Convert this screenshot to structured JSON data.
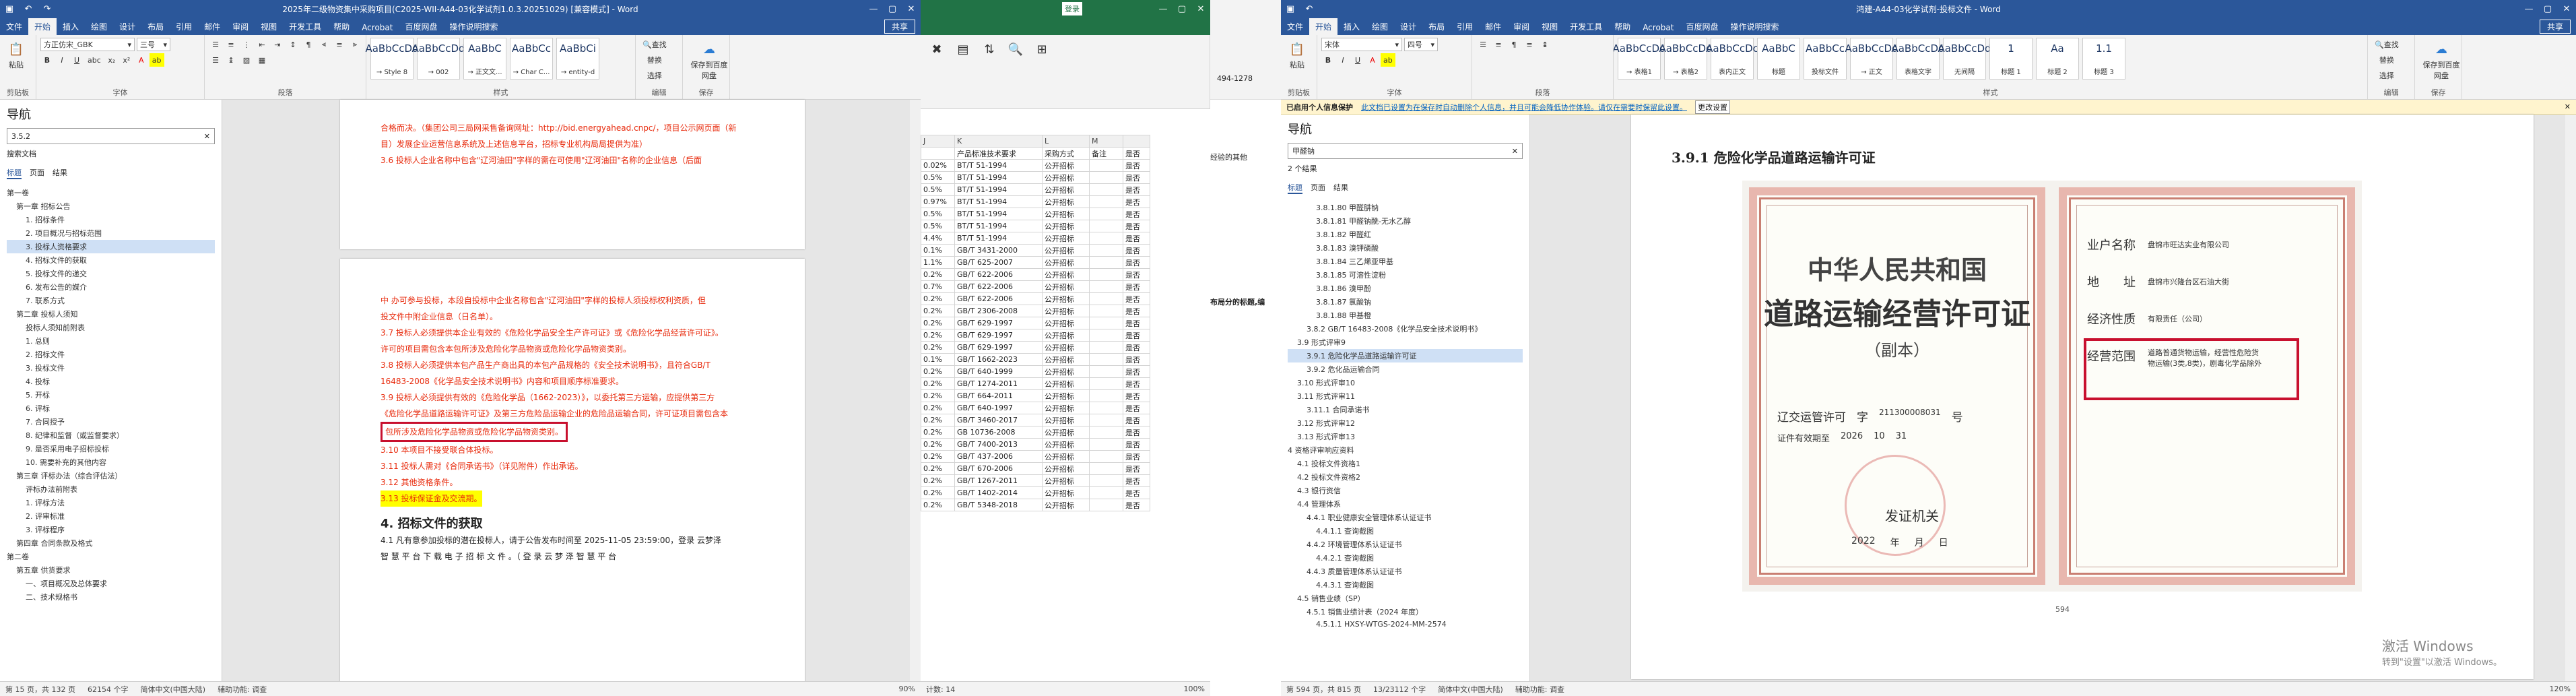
{
  "word1": {
    "title": "2025年二级物资集中采购项目(C2025-WII-A44-03化学试剂1.0.3.20251029) [兼容模式] - Word",
    "share": "共享",
    "menu": [
      "文件",
      "开始",
      "插入",
      "绘图",
      "设计",
      "布局",
      "引用",
      "邮件",
      "审阅",
      "视图",
      "开发工具",
      "帮助",
      "Acrobat",
      "百度网盘",
      "操作说明搜索"
    ],
    "ribbon": {
      "clipboard": "剪贴板",
      "paste": "粘贴",
      "font_name": "方正仿宋_GBK",
      "font_size": "三号",
      "font": "字体",
      "paragraph": "段落",
      "styles": "样式",
      "editing": "编辑",
      "save": "保存",
      "style_items": [
        {
          "sample": "AaBbCcDd",
          "name": "→ Style 8"
        },
        {
          "sample": "AaBbCcDd",
          "name": "→ 002"
        },
        {
          "sample": "AaBbC",
          "name": "→ 正文文..."
        },
        {
          "sample": "AaBbCc",
          "name": "→ Char C..."
        },
        {
          "sample": "AaBbCi",
          "name": "→ entity-d"
        }
      ],
      "find": "查找",
      "replace": "替换",
      "select": "选择",
      "save_baidu": "保存到百度网盘"
    },
    "nav": {
      "title": "导航",
      "search": "3.5.2",
      "search_doc": "搜索文档",
      "tabs": [
        "标题",
        "页面",
        "结果"
      ],
      "items": [
        "第一卷",
        "第一章 招标公告",
        "1. 招标条件",
        "2. 项目概况与招标范围",
        "3. 投标人资格要求",
        "4. 招标文件的获取",
        "5. 投标文件的递交",
        "6. 发布公告的媒介",
        "7. 联系方式",
        "第二章 投标人须知",
        "投标人须知前附表",
        "1. 总则",
        "2. 招标文件",
        "3. 投标文件",
        "4. 投标",
        "5. 开标",
        "6. 评标",
        "7. 合同授予",
        "8. 纪律和监督（或监督要求）",
        "9. 是否采用电子招标投标",
        "10. 需要补充的其他内容",
        "第三章 评标办法（综合评估法）",
        "评标办法前附表",
        "1. 评标方法",
        "2. 评审标准",
        "3. 评标程序",
        "第四章 合同条款及格式",
        "第二卷",
        "第五章 供货要求",
        "一、项目概况及总体要求",
        "二、技术规格书"
      ]
    },
    "doc": {
      "p1": "合格而决。（集团公司三局网采售备询网址：http://bid.energyahead.cnpc/，项目公示网页面（新",
      "p2": "目）发展企业运营信息系统及上述信息平台，招标专业机构局局提供为准）",
      "p3": "3.6 投标人企业名称中包含\"辽河油田\"字样的需在可使用\"辽河油田\"名称的企业信息（后面",
      "p4": "中 办可参与投标，本段自投标中企业名称包含\"辽河油田\"字样的投标人须投标权利资质，但",
      "p5": "投文件中附企业信息（日名单）。",
      "p6": "3.7 投标人必须提供本企业有效的《危险化学品安全生产许可证》或《危险化学品经营许可证》。",
      "p7": "许可的项目需包含本包所涉及危险化学品物资或危险化学品物资类别。",
      "p8": "3.8 投标人必须提供本包产品生产商出具的本包产品规格的《安全技术说明书》，且符合GB/T",
      "p9": "16483-2008《化学品安全技术说明书》内容和项目顺序标准要求。",
      "p10": "3.9 投标人必须提供有效的《危险化学品（1662-2023）》，以委托第三方运输，应提供第三方",
      "p11": "《危险化学品道路运输许可证》及第三方危险品运输企业的危险品运输合同，许可证项目需包含本",
      "p12": "包所涉及危险化学品物资或危险化学品物资类别。",
      "p13": "3.10 本项目不接受联合体投标。",
      "p14": "3.11 投标人需对《合同承诺书》（详见附件）作出承诺。",
      "p15": "3.12 其他资格条件。",
      "p16": "3.13 投标保证金及交流期。",
      "heading": "4. 招标文件的获取",
      "p17": "4.1 凡有意参加投标的潜在投标人，请于公告发布时间至 2025-11-05 23:59:00，登录 云梦泽",
      "p18": "智 慧 平 台 下 载 电 子 招 标 文 件 。（ 登 录 云 梦 泽 智 慧 平 台"
    },
    "status": {
      "page": "第 15 页，共 132 页",
      "words": "62154 个字",
      "lang": "简体中文(中国大陆)",
      "access": "辅助功能: 调查",
      "zoom": "90%"
    }
  },
  "excel": {
    "login": "登录",
    "cols": [
      "J",
      "K",
      "L",
      "M"
    ],
    "headers": [
      "",
      "产品标准技术要求",
      "采购方式",
      "备注",
      "是否"
    ],
    "rows": [
      [
        "0.02%",
        "BT/T 51-1994",
        "公开招标",
        "",
        "是否"
      ],
      [
        "0.5%",
        "BT/T 51-1994",
        "公开招标",
        "",
        "是否"
      ],
      [
        "0.5%",
        "BT/T 51-1994",
        "公开招标",
        "",
        "是否"
      ],
      [
        "0.97%",
        "BT/T 51-1994",
        "公开招标",
        "",
        "是否"
      ],
      [
        "0.5%",
        "BT/T 51-1994",
        "公开招标",
        "",
        "是否"
      ],
      [
        "0.5%",
        "BT/T 51-1994",
        "公开招标",
        "",
        "是否"
      ],
      [
        "4.4%",
        "BT/T 51-1994",
        "公开招标",
        "",
        "是否"
      ],
      [
        "0.1%",
        "GB/T 3431-2000",
        "公开招标",
        "",
        "是否"
      ],
      [
        "1.1%",
        "GB/T 625-2007",
        "公开招标",
        "",
        "是否"
      ],
      [
        "0.2%",
        "GB/T 622-2006",
        "公开招标",
        "",
        "是否"
      ],
      [
        "0.7%",
        "GB/T 622-2006",
        "公开招标",
        "",
        "是否"
      ],
      [
        "0.2%",
        "GB/T 622-2006",
        "公开招标",
        "",
        "是否"
      ],
      [
        "0.2%",
        "GB/T 2306-2008",
        "公开招标",
        "",
        "是否"
      ],
      [
        "0.2%",
        "GB/T 629-1997",
        "公开招标",
        "",
        "是否"
      ],
      [
        "0.2%",
        "GB/T 629-1997",
        "公开招标",
        "",
        "是否"
      ],
      [
        "0.2%",
        "GB/T 629-1997",
        "公开招标",
        "",
        "是否"
      ],
      [
        "0.1%",
        "GB/T 1662-2023",
        "公开招标",
        "",
        "是否"
      ],
      [
        "0.2%",
        "GB/T 640-1999",
        "公开招标",
        "",
        "是否"
      ],
      [
        "0.2%",
        "GB/T 1274-2011",
        "公开招标",
        "",
        "是否"
      ],
      [
        "0.2%",
        "GB/T 664-2011",
        "公开招标",
        "",
        "是否"
      ],
      [
        "0.2%",
        "GB/T 640-1997",
        "公开招标",
        "",
        "是否"
      ],
      [
        "0.2%",
        "GB/T 3460-2017",
        "公开招标",
        "",
        "是否"
      ],
      [
        "0.2%",
        "GB 10736-2008",
        "公开招标",
        "",
        "是否"
      ],
      [
        "0.2%",
        "GB/T 7400-2013",
        "公开招标",
        "",
        "是否"
      ],
      [
        "0.2%",
        "GB/T 437-2006",
        "公开招标",
        "",
        "是否"
      ],
      [
        "0.2%",
        "GB/T 670-2006",
        "公开招标",
        "",
        "是否"
      ],
      [
        "0.2%",
        "GB/T 1267-2011",
        "公开招标",
        "",
        "是否"
      ],
      [
        "0.2%",
        "GB/T 1402-2014",
        "公开招标",
        "",
        "是否"
      ],
      [
        "0.2%",
        "GB/T 5348-2018",
        "公开招标",
        "",
        "是否"
      ]
    ],
    "status": "计数: 14",
    "zoom": "100%"
  },
  "midwin": {
    "text1": "494-1278",
    "text2": "经验的其他",
    "text3": "布局分的标题,编"
  },
  "word2": {
    "title": "鸿建-A44-03化学试剂-投标文件 - Word",
    "share": "共享",
    "menu": [
      "文件",
      "开始",
      "插入",
      "绘图",
      "设计",
      "布局",
      "引用",
      "邮件",
      "审阅",
      "视图",
      "开发工具",
      "帮助",
      "Acrobat",
      "百度网盘",
      "操作说明搜索"
    ],
    "ribbon": {
      "font_name": "宋体",
      "font_size": "四号",
      "style_items": [
        {
          "sample": "AaBbCcDd",
          "name": "→ 表格1"
        },
        {
          "sample": "AaBbCcDd",
          "name": "→ 表格2"
        },
        {
          "sample": "AaBbCcDc",
          "name": "表内正文"
        },
        {
          "sample": "AaBbC",
          "name": "标题"
        },
        {
          "sample": "AaBbCc",
          "name": "投标文件"
        },
        {
          "sample": "AaBbCcDd",
          "name": "→ 正文"
        },
        {
          "sample": "AaBbCcDd",
          "name": "表格文字"
        },
        {
          "sample": "AaBbCcDd",
          "name": "无间隔"
        },
        {
          "sample": "1",
          "name": "标题 1"
        },
        {
          "sample": "Aa",
          "name": "标题 2"
        },
        {
          "sample": "1.1",
          "name": "标题 3"
        }
      ]
    },
    "infobar": {
      "label": "已启用个人信息保护",
      "text": "此文档已设置为在保存时自动删除个人信息，并且可能会降低协作体验。请仅在需要时保留此设置。",
      "button": "更改设置"
    },
    "nav": {
      "title": "导航",
      "search": "甲醛钠",
      "results": "2 个结果",
      "tabs": [
        "标题",
        "页面",
        "结果"
      ],
      "items": [
        {
          "t": "3.8.1.80 甲醛肼钠",
          "l": 3
        },
        {
          "t": "3.8.1.81 甲醛钠酰-无水乙醇",
          "l": 3
        },
        {
          "t": "3.8.1.82 甲醛红",
          "l": 3
        },
        {
          "t": "3.8.1.83 溴钾磷酸",
          "l": 3
        },
        {
          "t": "3.8.1.84 三乙烯亚甲基",
          "l": 3
        },
        {
          "t": "3.8.1.85 可溶性淀粉",
          "l": 3
        },
        {
          "t": "3.8.1.86 溴甲酚",
          "l": 3
        },
        {
          "t": "3.8.1.87 氯酸钠",
          "l": 3
        },
        {
          "t": "3.8.1.88 甲基橙",
          "l": 3
        },
        {
          "t": "3.8.2 GB/T 16483-2008《化学品安全技术说明书》",
          "l": 2
        },
        {
          "t": "3.9 形式评审9",
          "l": 1
        },
        {
          "t": "3.9.1 危险化学品道路运输许可证",
          "l": 2,
          "sel": true
        },
        {
          "t": "3.9.2 危化品运输合同",
          "l": 2
        },
        {
          "t": "3.10 形式评审10",
          "l": 1
        },
        {
          "t": "3.11 形式评审11",
          "l": 1
        },
        {
          "t": "3.11.1 合同承诺书",
          "l": 2
        },
        {
          "t": "3.12 形式评审12",
          "l": 1
        },
        {
          "t": "3.13 形式评审13",
          "l": 1
        },
        {
          "t": "4 资格评审响应资料",
          "l": 0
        },
        {
          "t": "4.1 投标文件资格1",
          "l": 1
        },
        {
          "t": "4.2 投标文件资格2",
          "l": 1
        },
        {
          "t": "4.3 银行资信",
          "l": 1
        },
        {
          "t": "4.4 管理体系",
          "l": 1
        },
        {
          "t": "4.4.1 职业健康安全管理体系认证证书",
          "l": 2
        },
        {
          "t": "4.4.1.1 查询截图",
          "l": 3
        },
        {
          "t": "4.4.2 环境管理体系认证证书",
          "l": 2
        },
        {
          "t": "4.4.2.1 查询截图",
          "l": 3
        },
        {
          "t": "4.4.3 质量管理体系认证证书",
          "l": 2
        },
        {
          "t": "4.4.3.1 查询截图",
          "l": 3
        },
        {
          "t": "4.5 销售业绩（SP）",
          "l": 1
        },
        {
          "t": "4.5.1 销售业绩计表（2024 年度）",
          "l": 2
        },
        {
          "t": "4.5.1.1 HXSY-WTGS-2024-MM-2574",
          "l": 3
        }
      ]
    },
    "doc": {
      "heading": "3.9.1 危险化学品道路运输许可证",
      "permit_country": "中华人民共和国",
      "permit_title": "道路运输经营许可证",
      "permit_copy": "（副本）",
      "permit_word_label": "辽交运管许可",
      "permit_zi": "字",
      "permit_number": "211300008031",
      "permit_hao": "号",
      "permit_valid": "证件有效期至",
      "permit_date_y": "2026",
      "permit_date_m": "10",
      "permit_date_d": "31",
      "issue_office": "发证机关",
      "issue_year": "2022",
      "issue_y": "年",
      "issue_m": "月",
      "issue_d": "日",
      "owner_label": "业户名称",
      "owner_value": "盘锦市旺达实业有限公司",
      "addr_label": "地　　址",
      "addr_value": "盘锦市兴隆台区石油大街",
      "econ_label": "经济性质",
      "econ_value": "有限责任（公司）",
      "scope_label": "经营范围",
      "scope_value": "道路普通货物运输，经营性危险货物运输(3类,8类)，剧毒化学品除外",
      "page_no": "594"
    },
    "activate": {
      "line1": "激活 Windows",
      "line2": "转到\"设置\"以激活 Windows。"
    },
    "status": {
      "page": "第 594 页，共 815 页",
      "words": "13/23112 个字",
      "lang": "简体中文(中国大陆)",
      "access": "辅助功能: 调查",
      "zoom": "120%"
    }
  }
}
